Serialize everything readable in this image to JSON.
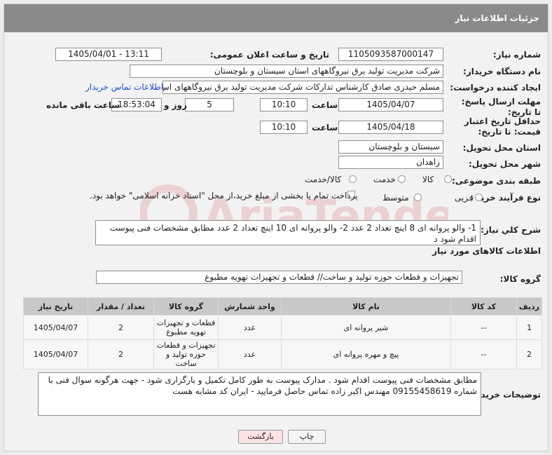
{
  "title": "جزئیات اطلاعات نیاز",
  "labels": {
    "need_number": "شماره نیاز:",
    "announce_datetime": "تاریخ و ساعت اعلان عمومی:",
    "buyer_org": "نام دستگاه خریدار:",
    "requester": "ایجاد کننده درخواست:",
    "send_deadline": "مهلت ارسال پاسخ: تا تاریخ:",
    "min_validity": "حداقل تاریخ اعتبار قیمت: تا تاریخ:",
    "delivery_province": "استان محل تحویل:",
    "delivery_city": "شهر محل تحویل:",
    "category": "طبقه بندی موضوعی:",
    "purchase_type": "نوع فرآیند خرید :",
    "time": "ساعت",
    "day_and": "روز و",
    "remaining": "ساعت باقی مانده",
    "general_desc": "شرح کلي نياز:",
    "items_info": "اطلاعات کالاهای مورد نیاز",
    "goods_group": "گروه کالا:",
    "buyer_notes": "توضیحات خریدار:"
  },
  "fields": {
    "need_number": "1105093587000147",
    "announce_datetime": "1405/04/01 - 13:11",
    "buyer_org": "شرکت مدیریت تولید برق نیروگاههای استان سیستان و بلوچستان",
    "requester": "مسلم حیدری صادق کارشناس تدارکات شرکت مدیریت تولید برق نیروگاههای اس",
    "buyer_contact_link": "اطلاعات تماس خریدار",
    "send_date": "1405/04/07",
    "send_time": "10:10",
    "send_days": "5",
    "send_remaining": "18:53:04",
    "validity_date": "1405/04/18",
    "validity_time": "10:10",
    "province": "سیستان و بلوچستان",
    "city": "زاهدان"
  },
  "category_options": [
    "کالا",
    "خدمت",
    "کالا/خدمت"
  ],
  "purchase_options": [
    "جزیی",
    "متوسط"
  ],
  "payment_note": "پرداخت تمام یا بخشی از مبلغ خرید،از محل \"اسناد خزانه اسلامی\" خواهد بود.",
  "general_desc": "1- والو پروانه ای 8 اینچ  تعداد  2 عدد       2- والو پروانه ای 10 اینچ تعداد 2 عدد      مطابق مشخصات فنی پیوست اقدام شود د",
  "goods_group": "تجهیزات و قطعات حوزه تولید و ساخت//  قطعات و تجهیزات تهویه مطبوع",
  "table": {
    "headers": [
      "ردیف",
      "کد کالا",
      "نام کالا",
      "واحد شمارش",
      "گروه کالا",
      "تعداد / مقدار",
      "تاریخ نیاز"
    ],
    "rows": [
      [
        "1",
        "--",
        "شیر پروانه ای",
        "عدد",
        "قطعات و تجهیزات تهویه مطبوع",
        "2",
        "1405/04/07"
      ],
      [
        "2",
        "--",
        "پیچ و مهره پروانه ای",
        "عدد",
        "تجهیزات و قطعات حوزه تولید و ساخت",
        "2",
        "1405/04/07"
      ]
    ]
  },
  "buyer_notes": "مطابق مشخصات فنی پیوست اقدام شود . مدارک پیوست به طور کامل تکمیل و بارگزاری شود - جهت هرگونه سوال فنی با شماره 09155458619 مهندس اکبر زاده تماس حاصل فرمایید - ایران کد مشابه هست",
  "buttons": {
    "print": "چاپ",
    "back": "بازگشت"
  },
  "watermark_text": "AriaTender.net",
  "colors": {
    "titlebar": "#8a8a8a",
    "link": "#1a4fd1",
    "back_button": "#fde3e3"
  }
}
